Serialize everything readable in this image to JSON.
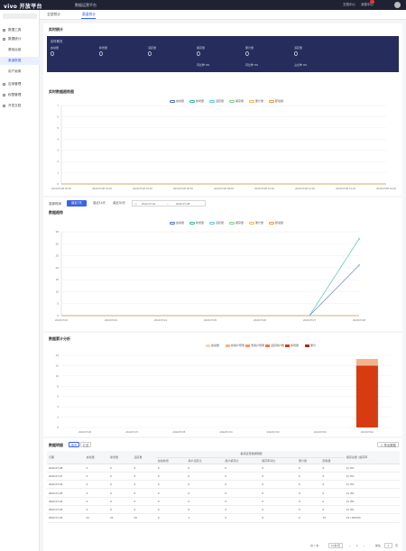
{
  "topbar": {
    "logo": "vivo 开放平台",
    "logo_sub": "开放平台",
    "title": "数据运营平台",
    "right_links": [
      "文档中心",
      "消息中心"
    ],
    "badge_count": "1",
    "user": "用户"
  },
  "sidebar": {
    "items": [
      {
        "label": "数据工具",
        "icon": "grid-icon",
        "sub": false,
        "active": false
      },
      {
        "label": "数据统计",
        "icon": "chart-icon",
        "sub": false,
        "active": false
      },
      {
        "label": "基础运营",
        "icon": "",
        "sub": true,
        "active": false
      },
      {
        "label": "渠道数据",
        "icon": "",
        "sub": true,
        "active": true
      },
      {
        "label": "用户画像",
        "icon": "",
        "sub": true,
        "active": false
      },
      {
        "label": "应用管理",
        "icon": "app-icon",
        "sub": false,
        "active": false
      },
      {
        "label": "权限管理",
        "icon": "lock-icon",
        "sub": false,
        "active": false
      },
      {
        "label": "开发文档",
        "icon": "doc-icon",
        "sub": false,
        "active": false
      }
    ]
  },
  "tabs": [
    "全部统计",
    "渠道统计"
  ],
  "realtime": {
    "section_title": "实时统计",
    "card_title": "实时概况",
    "columns": [
      {
        "label": "启动量",
        "value": "0",
        "sub": ""
      },
      {
        "label": "新增量",
        "value": "0",
        "sub": ""
      },
      {
        "label": "活跃量",
        "value": "0",
        "sub": ""
      },
      {
        "label": "留存量",
        "value": "0",
        "sub": "同比昨 0%"
      },
      {
        "label": "累计量",
        "value": "0",
        "sub": "同比昨 0%"
      },
      {
        "label": "活跃量",
        "value": "0",
        "sub": "占比昨 0%"
      }
    ]
  },
  "realtime_trend": {
    "title": "实时数据趋势图",
    "legend": [
      "启动量",
      "新增量",
      "活跃量",
      "留存量",
      "累计量",
      "卸载量"
    ]
  },
  "filters": {
    "label": "选择时间",
    "buttons": [
      "最近7天",
      "最近14天",
      "最近30天"
    ],
    "date_start": "2022-07-22",
    "date_sep": "~",
    "date_end": "2022-07-28"
  },
  "trend": {
    "title": "数据趋势",
    "legend": [
      "启动量",
      "新增量",
      "活跃量",
      "留存量",
      "累计量",
      "卸载量"
    ]
  },
  "stack": {
    "title": "数据累计分析",
    "legend": [
      "启动量",
      "新用户登录",
      "老用户登录",
      "活跃用户数",
      "新增量",
      "累计"
    ]
  },
  "table": {
    "title": "数据明细",
    "toggle": [
      "按天",
      "汇总"
    ],
    "export": "导出数据",
    "header_group": "各项运营数据明细",
    "columns": [
      "日期",
      "启动量",
      "新增量",
      "活跃量",
      "启动新增",
      "用户活跃比",
      "用户留存比",
      "留存率对比",
      "累计量",
      "卸载量",
      "留存总量 | 留存率"
    ],
    "rows": [
      [
        "2022-07-28",
        "0",
        "0",
        "0",
        "0",
        "0",
        "0",
        "0",
        "0",
        "0",
        "0 | 0%"
      ],
      [
        "2022-07-27",
        "0",
        "0",
        "0",
        "0",
        "0",
        "0",
        "0",
        "0",
        "0",
        "0 | 0%"
      ],
      [
        "2022-07-26",
        "0",
        "0",
        "0",
        "0",
        "0",
        "0",
        "0",
        "0",
        "0",
        "0 | 0%"
      ],
      [
        "2022-07-25",
        "0",
        "0",
        "0",
        "0",
        "0",
        "0",
        "0",
        "0",
        "0",
        "0 | 0%"
      ],
      [
        "2022-07-24",
        "0",
        "0",
        "0",
        "0",
        "0",
        "0",
        "0",
        "0",
        "0",
        "0 | 0%"
      ],
      [
        "2022-07-23",
        "0",
        "0",
        "0",
        "0",
        "0",
        "0",
        "0",
        "0",
        "0",
        "0 | 0%"
      ],
      [
        "2022-07-22",
        "21",
        "21",
        "23",
        "0",
        "1",
        "0",
        "0",
        "0",
        "13",
        "13 | 100.0%"
      ]
    ],
    "pager": {
      "total": "共 7 条",
      "page_size": "10条/页",
      "prev": "‹",
      "page": "1",
      "next": "›",
      "goto": "前往",
      "goto_page": "1",
      "unit": "页"
    }
  },
  "chart_data": [
    {
      "type": "line",
      "title": "实时数据趋势图",
      "x": [
        "2022/07/28 00:00",
        "2022/07/28 02:00",
        "2022/07/28 04:00",
        "2022/07/28 06:00",
        "2022/07/28 08:00",
        "2022/07/28 10:00",
        "2022/07/28 12:00",
        "2022/07/28 14:00",
        "2022/07/28 16:00"
      ],
      "ylim": [
        0,
        7
      ],
      "yticks": [
        0,
        1,
        2,
        3,
        4,
        5,
        6,
        7
      ],
      "series": [
        {
          "name": "启动量",
          "color": "#4f6fd8",
          "values": [
            0,
            0,
            0,
            0,
            0,
            0,
            0,
            0,
            0
          ]
        },
        {
          "name": "新增量",
          "color": "#35b6a6",
          "values": [
            0,
            0,
            0,
            0,
            0,
            0,
            0,
            0,
            0
          ]
        },
        {
          "name": "活跃量",
          "color": "#5ec3e8",
          "values": [
            0,
            0,
            0,
            0,
            0,
            0,
            0,
            0,
            0
          ]
        },
        {
          "name": "留存量",
          "color": "#7fcf8f",
          "values": [
            0,
            0,
            0,
            0,
            0,
            0,
            0,
            0,
            0
          ]
        },
        {
          "name": "累计量",
          "color": "#f0b85a",
          "values": [
            0,
            0,
            0,
            0,
            0,
            0,
            0,
            0,
            0
          ]
        },
        {
          "name": "卸载量",
          "color": "#e39a56",
          "values": [
            0,
            0,
            0,
            0,
            0,
            0,
            0,
            0,
            0
          ]
        }
      ]
    },
    {
      "type": "line",
      "title": "数据趋势",
      "x": [
        "2022/07/22",
        "2022/07/23",
        "2022/07/24",
        "2022/07/25",
        "2022/07/26",
        "2022/07/27",
        "2022/07/28"
      ],
      "ylim": [
        0,
        35
      ],
      "yticks": [
        0,
        5,
        10,
        15,
        20,
        25,
        30,
        35
      ],
      "series": [
        {
          "name": "启动量",
          "color": "#4f6fd8",
          "values": [
            0,
            0,
            0,
            0,
            0,
            0,
            21
          ]
        },
        {
          "name": "新增量",
          "color": "#35b6a6",
          "values": [
            0,
            0,
            0,
            0,
            0,
            0,
            32
          ]
        },
        {
          "name": "活跃量",
          "color": "#5ec3e8",
          "values": [
            0,
            0,
            0,
            0,
            0,
            0,
            0
          ]
        },
        {
          "name": "留存量",
          "color": "#7fcf8f",
          "values": [
            0,
            0,
            0,
            0,
            0,
            0,
            0
          ]
        },
        {
          "name": "累计量",
          "color": "#f0b85a",
          "values": [
            0,
            0,
            0,
            0,
            0,
            0,
            0
          ]
        },
        {
          "name": "卸载量",
          "color": "#e39a56",
          "values": [
            0,
            0,
            0,
            0,
            0,
            0,
            0
          ]
        }
      ]
    },
    {
      "type": "bar",
      "title": "数据累计分析",
      "categories": [
        "2022/07/26",
        "2022/07/27",
        "2022/07/25",
        "2022/07/24",
        "2022/07/23",
        "2022/07/23",
        "2022/07/22"
      ],
      "ylim": [
        0,
        14
      ],
      "yticks": [
        0,
        2,
        4,
        6,
        8,
        10,
        12,
        14
      ],
      "series": [
        {
          "name": "新增量",
          "color": "#d63b12",
          "values": [
            0,
            0,
            0,
            0,
            0,
            0,
            12
          ]
        },
        {
          "name": "启动量",
          "color": "#f4b48a",
          "values": [
            0,
            0,
            0,
            0,
            0,
            0,
            1.3
          ]
        }
      ]
    }
  ]
}
